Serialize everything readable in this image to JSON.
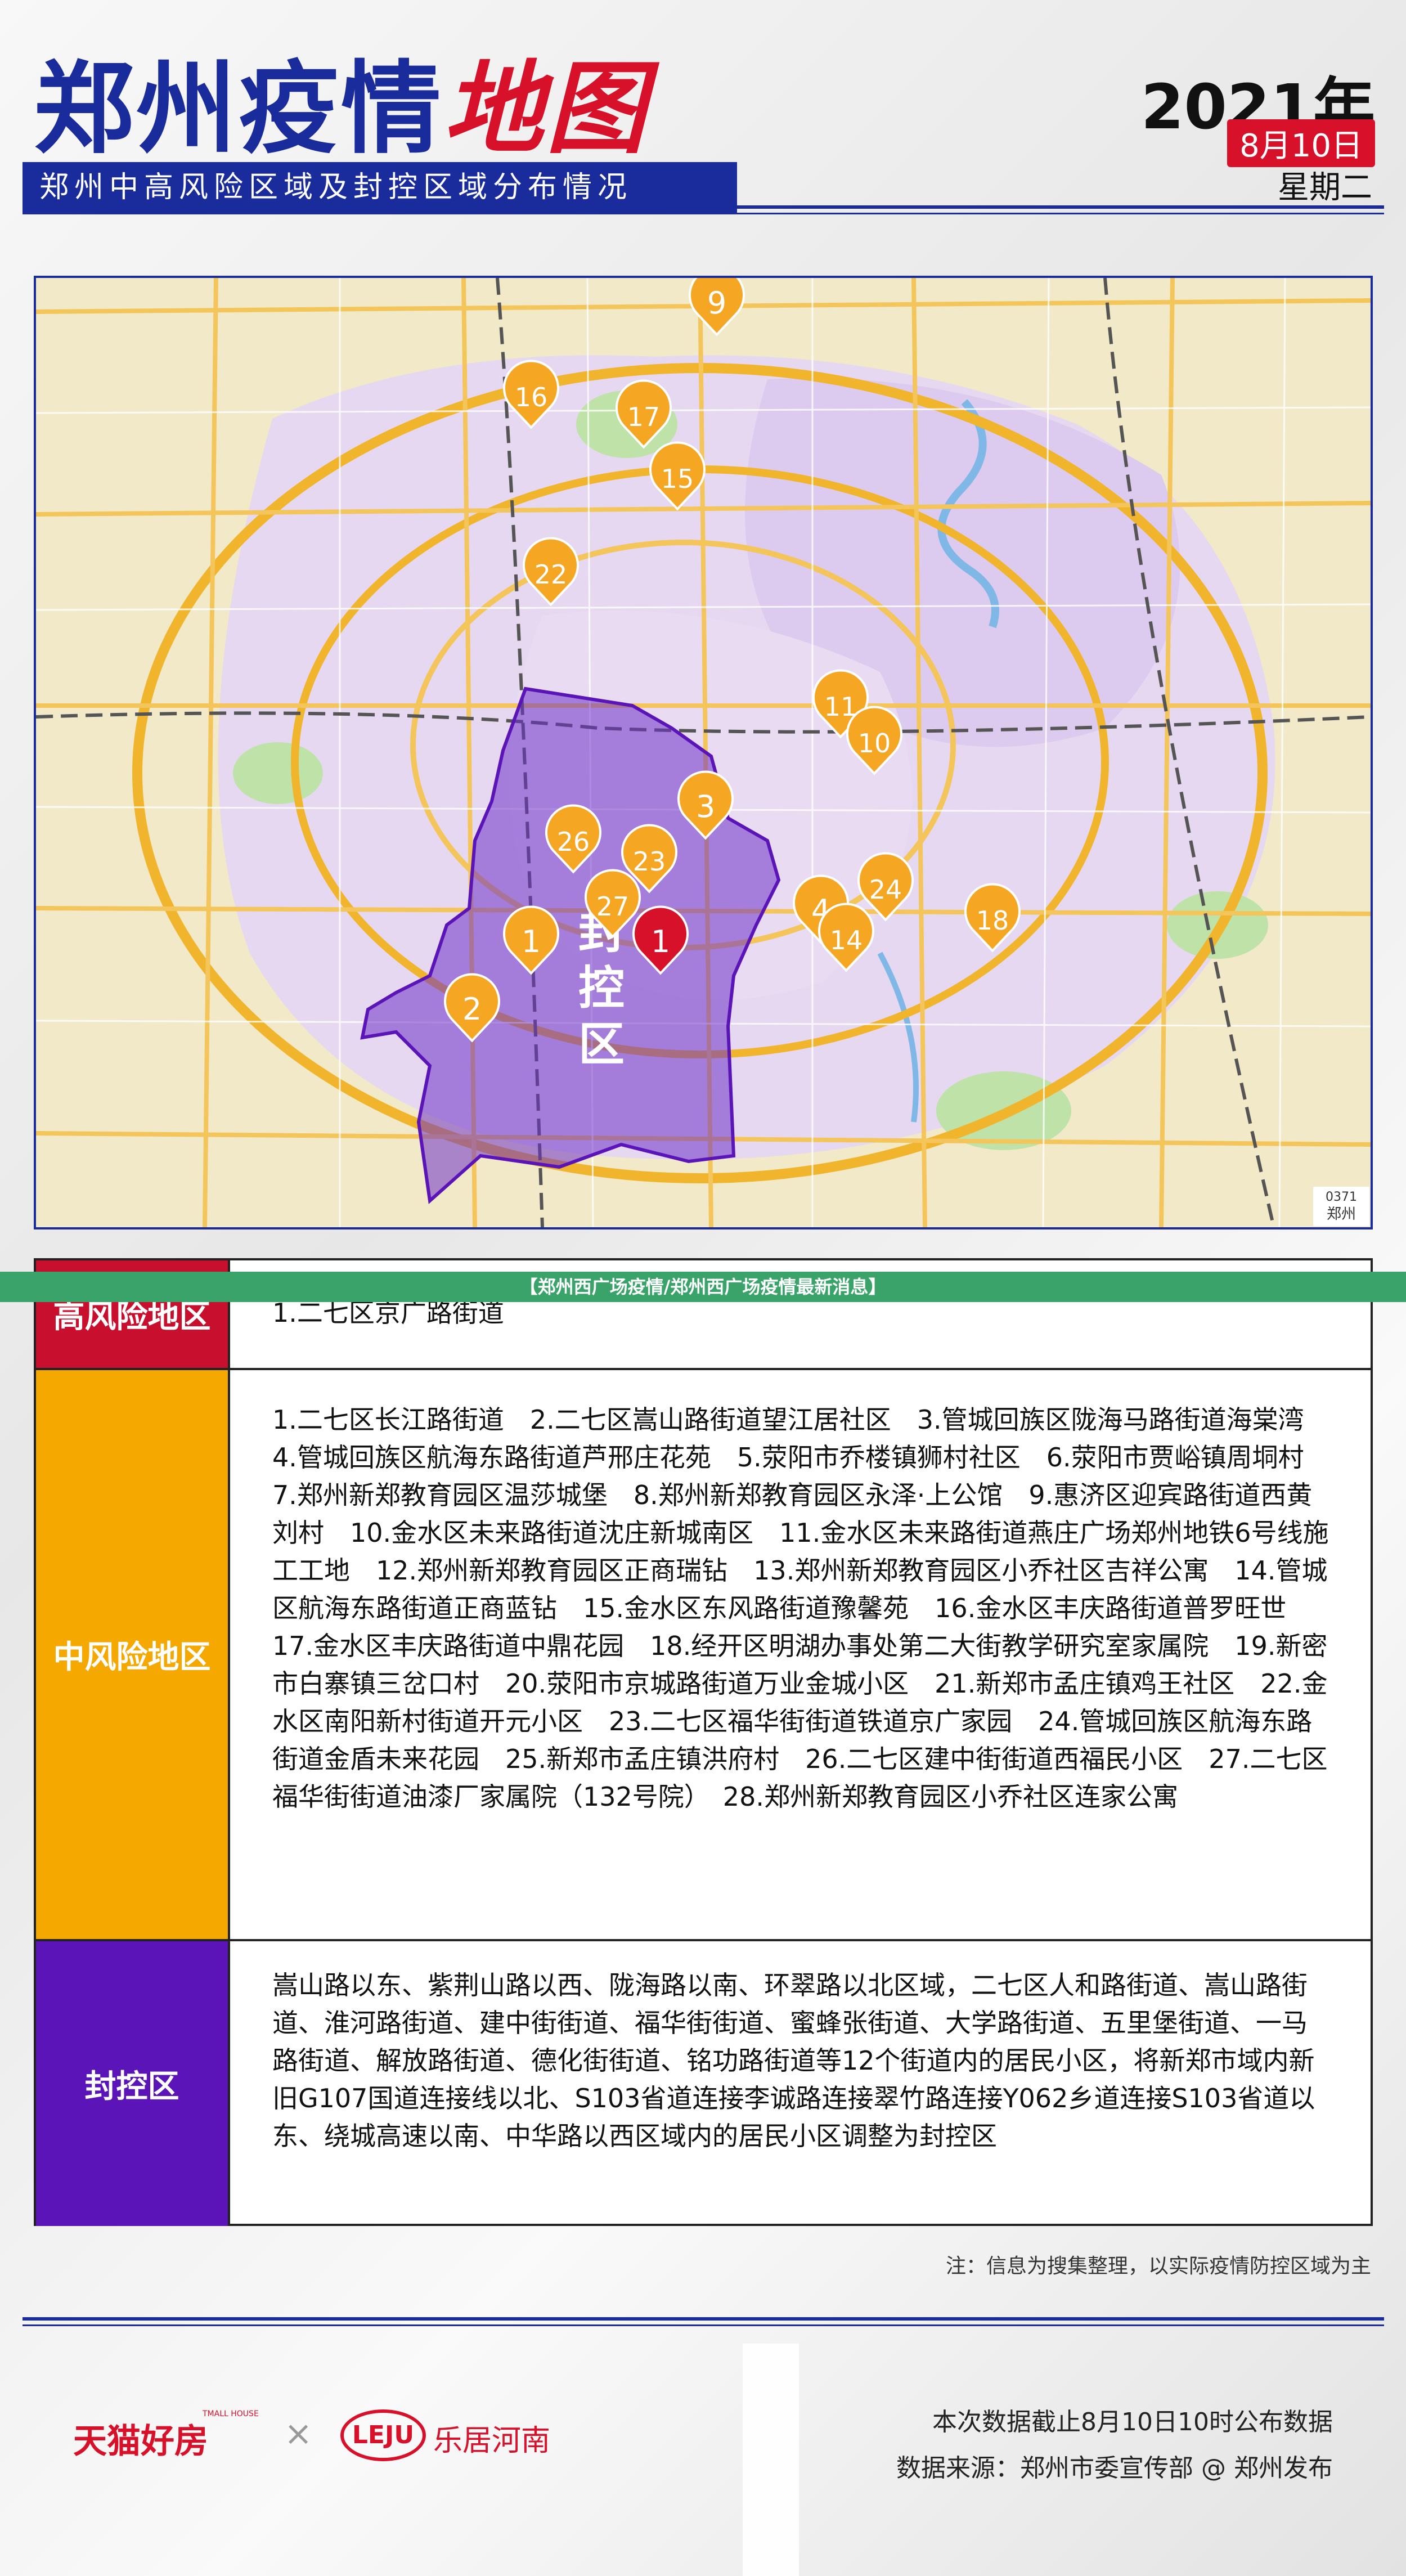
{
  "header": {
    "title_main": "郑州疫情",
    "title_red": "地图",
    "subtitle": "郑州中高风险区域及封控区域分布情况",
    "year": "2021年",
    "date": "8月10日",
    "weekday": "星期二"
  },
  "map": {
    "locked_label": "封控区",
    "area_code": "0371",
    "city_label": "郑州",
    "markers": [
      {
        "label": "9",
        "color": "#f5a623"
      },
      {
        "label": "16",
        "color": "#f5a623"
      },
      {
        "label": "17",
        "color": "#f5a623"
      },
      {
        "label": "15",
        "color": "#f5a623"
      },
      {
        "label": "22",
        "color": "#f5a623"
      },
      {
        "label": "11",
        "color": "#f5a623"
      },
      {
        "label": "10",
        "color": "#f5a623"
      },
      {
        "label": "3",
        "color": "#f5a623"
      },
      {
        "label": "26",
        "color": "#f5a623"
      },
      {
        "label": "23",
        "color": "#f5a623"
      },
      {
        "label": "27",
        "color": "#f5a623"
      },
      {
        "label": "24",
        "color": "#f5a623"
      },
      {
        "label": "4",
        "color": "#f5a623"
      },
      {
        "label": "14",
        "color": "#f5a623"
      },
      {
        "label": "18",
        "color": "#f5a623"
      },
      {
        "label": "1",
        "color": "#f5a623"
      },
      {
        "label": "1",
        "color": "#d8112b"
      },
      {
        "label": "2",
        "color": "#f5a623"
      }
    ]
  },
  "banner": "【郑州西广场疫情/郑州西广场疫情最新消息】",
  "table": {
    "high": {
      "label": "高风险地区",
      "color": "#c8102e",
      "content": "1.二七区京广路街道"
    },
    "medium": {
      "label": "中风险地区",
      "color": "#f5a800",
      "content": "1.二七区长江路街道　2.二七区嵩山路街道望江居社区　3.管城回族区陇海马路街道海棠湾　4.管城回族区航海东路街道芦邢庄花苑　5.荥阳市乔楼镇狮村社区　6.荥阳市贾峪镇周垌村　7.郑州新郑教育园区温莎城堡　8.郑州新郑教育园区永泽·上公馆　9.惠济区迎宾路街道西黄刘村　10.金水区未来路街道沈庄新城南区　11.金水区未来路街道燕庄广场郑州地铁6号线施工工地　12.郑州新郑教育园区正商瑞钻　13.郑州新郑教育园区小乔社区吉祥公寓　14.管城区航海东路街道正商蓝钻　15.金水区东风路街道豫馨苑　16.金水区丰庆路街道普罗旺世　17.金水区丰庆路街道中鼎花园　18.经开区明湖办事处第二大街教学研究室家属院　19.新密市白寨镇三岔口村　20.荥阳市京城路街道万业金城小区　21.新郑市孟庄镇鸡王社区　22.金水区南阳新村街道开元小区　23.二七区福华街街道铁道京广家园　24.管城回族区航海东路街道金盾未来花园　25.新郑市孟庄镇洪府村　26.二七区建中街街道西福民小区　27.二七区福华街街道油漆厂家属院（132号院）　28.郑州新郑教育园区小乔社区连家公寓"
    },
    "locked": {
      "label": "封控区",
      "color": "#5b14b8",
      "content": "嵩山路以东、紫荆山路以西、陇海路以南、环翠路以北区域，二七区人和路街道、嵩山路街道、淮河路街道、建中街街道、福华街街道、蜜蜂张街道、大学路街道、五里堡街道、一马路街道、解放路街道、德化街街道、铭功路街道等12个街道内的居民小区，将新郑市域内新旧G107国道连接线以北、S103省道连接李诚路连接翠竹路连接Y062乡道连接S103省道以东、绕城高速以南、中华路以西区域内的居民小区调整为封控区"
    }
  },
  "footer": {
    "note": "注：信息为搜集整理，以实际疫情防控区域为主",
    "tmall": "天猫好房",
    "tmall_sub": "TMALL HOUSE",
    "times": "×",
    "leju_logo": "LEJU",
    "leju_text": "乐居河南",
    "data_cutoff": "本次数据截止8月10日10时公布数据",
    "data_source": "数据来源：郑州市委宣传部 @ 郑州发布"
  }
}
